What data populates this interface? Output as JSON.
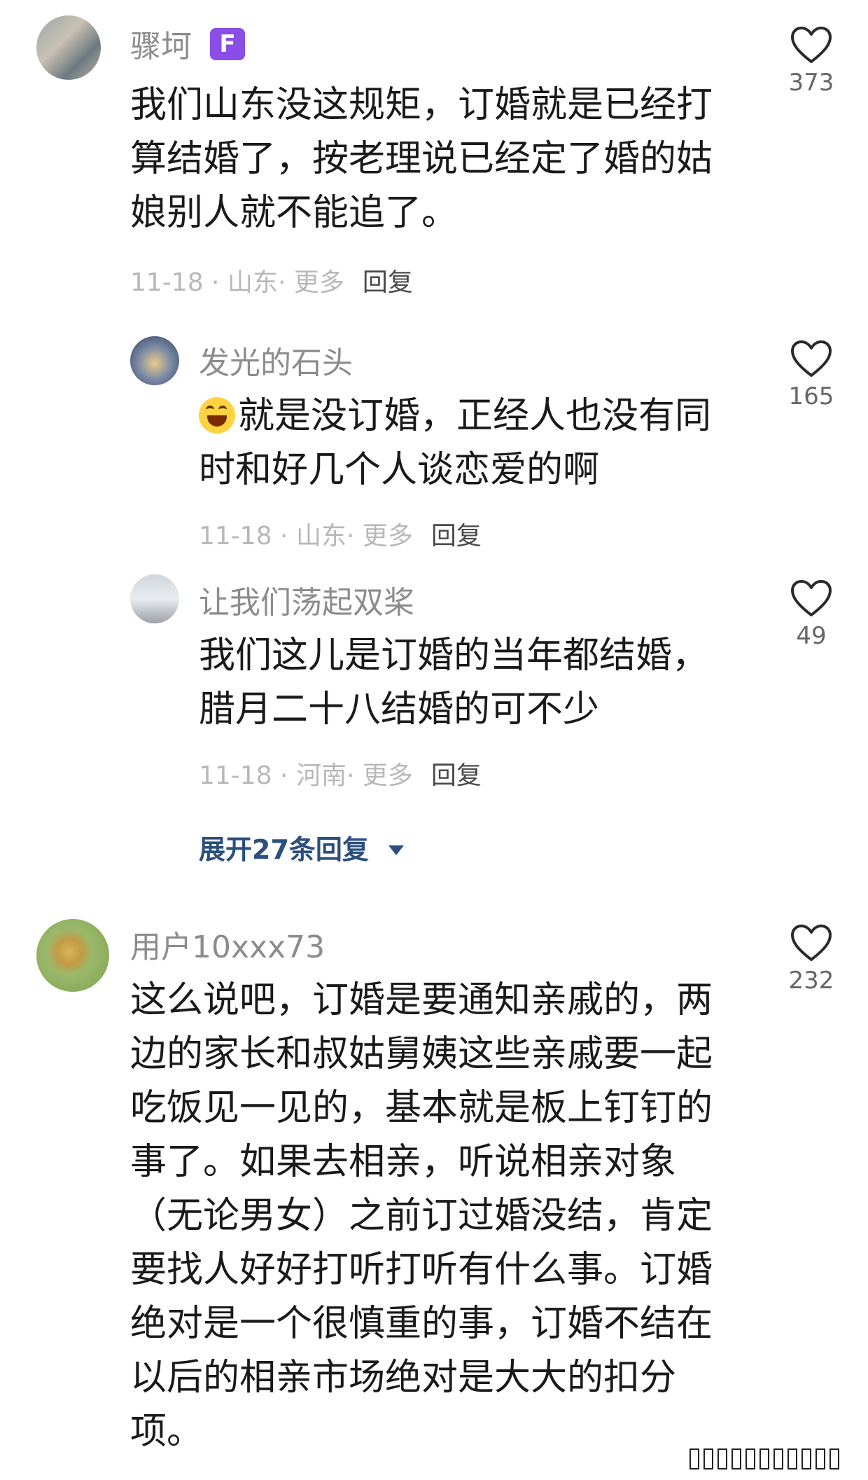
{
  "comments": [
    {
      "name": "骤坷",
      "badge": "F",
      "lines": [
        "我们山东没这规矩，订婚就是已经打",
        "算结婚了，按老理说已经定了婚的姑",
        "娘别人就不能追了。"
      ],
      "meta": "11-18 · 山东· 更多",
      "reply_label": "回复",
      "likes": "373"
    },
    {
      "name": "发光的石头",
      "lines": [
        "就是没订婚，正经人也没有同",
        "时和好几个人谈恋爱的啊"
      ],
      "meta": "11-18 · 山东· 更多",
      "reply_label": "回复",
      "likes": "165"
    },
    {
      "name": "让我们荡起双桨",
      "lines": [
        "我们这儿是订婚的当年都结婚，",
        "腊月二十八结婚的可不少"
      ],
      "meta": "11-18 · 河南· 更多",
      "reply_label": "回复",
      "likes": "49"
    },
    {
      "name": "用户10xxx73",
      "lines": [
        "这么说吧，订婚是要通知亲戚的，两",
        "边的家长和叔姑舅姨这些亲戚要一起",
        "吃饭见一见的，基本就是板上钉钉的",
        "事了。如果去相亲，听说相亲对象",
        "（无论男女）之前订过婚没结，肯定",
        "要找人好好打听打听有什么事。订婚",
        "绝对是一个很慎重的事，订婚不结在",
        "以后的相亲市场绝对是大大的扣分",
        "项。"
      ],
      "likes": "232"
    }
  ],
  "expand_replies": "展开27条回复",
  "icons": {
    "like": "heart-outline-icon",
    "expand": "caret-down-icon",
    "emoji": "laughing-crying-emoji"
  },
  "colors": {
    "name": "#8c8c8c",
    "meta": "#b8b8b8",
    "expand": "#2b4f7e",
    "badge": "#8a4de8"
  }
}
